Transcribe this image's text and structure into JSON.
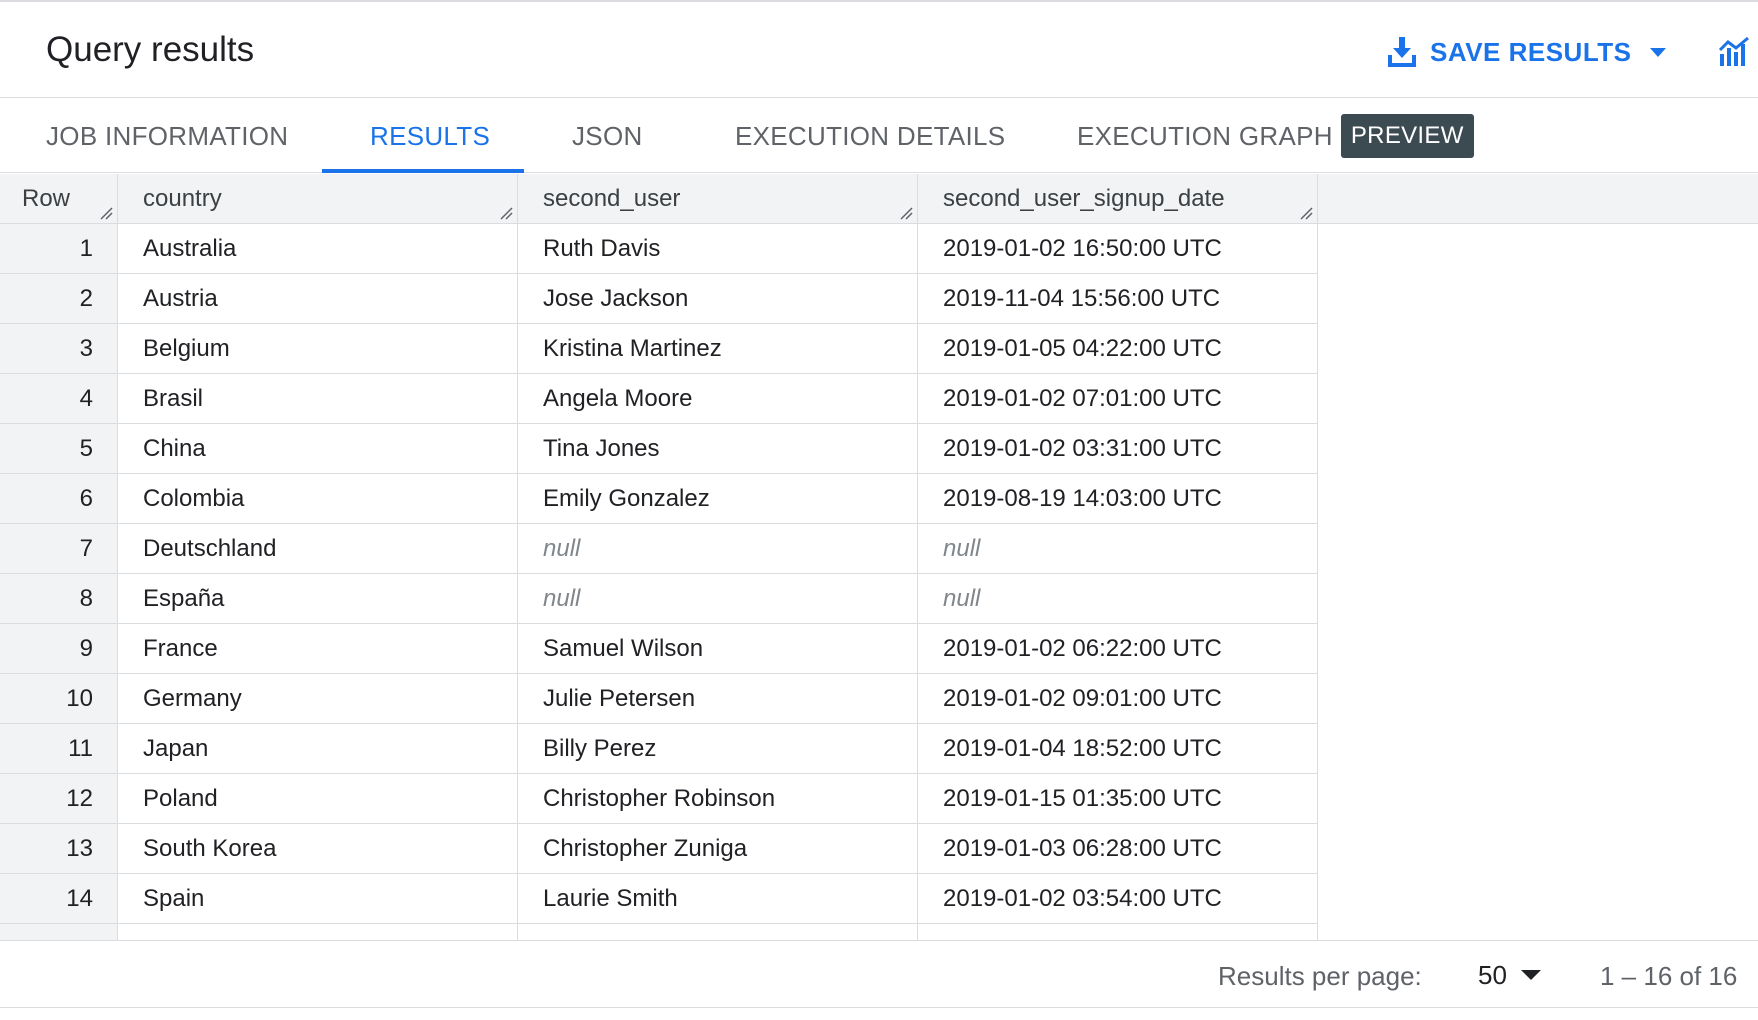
{
  "header": {
    "title": "Query results",
    "save_label": "SAVE RESULTS",
    "save_icon": "download-icon",
    "chart_icon": "explore-chart-icon",
    "accent_color": "#1a73e8"
  },
  "tabs": [
    {
      "label": "JOB INFORMATION",
      "active": false
    },
    {
      "label": "RESULTS",
      "active": true
    },
    {
      "label": "JSON",
      "active": false
    },
    {
      "label": "EXECUTION DETAILS",
      "active": false
    },
    {
      "label": "EXECUTION GRAPH",
      "active": false,
      "badge": "PREVIEW"
    }
  ],
  "table": {
    "columns": [
      "Row",
      "country",
      "second_user",
      "second_user_signup_date"
    ],
    "rows": [
      [
        "1",
        "Australia",
        "Ruth Davis",
        "2019-01-02 16:50:00 UTC"
      ],
      [
        "2",
        "Austria",
        "Jose Jackson",
        "2019-11-04 15:56:00 UTC"
      ],
      [
        "3",
        "Belgium",
        "Kristina Martinez",
        "2019-01-05 04:22:00 UTC"
      ],
      [
        "4",
        "Brasil",
        "Angela Moore",
        "2019-01-02 07:01:00 UTC"
      ],
      [
        "5",
        "China",
        "Tina Jones",
        "2019-01-02 03:31:00 UTC"
      ],
      [
        "6",
        "Colombia",
        "Emily Gonzalez",
        "2019-08-19 14:03:00 UTC"
      ],
      [
        "7",
        "Deutschland",
        "null",
        "null"
      ],
      [
        "8",
        "España",
        "null",
        "null"
      ],
      [
        "9",
        "France",
        "Samuel Wilson",
        "2019-01-02 06:22:00 UTC"
      ],
      [
        "10",
        "Germany",
        "Julie Petersen",
        "2019-01-02 09:01:00 UTC"
      ],
      [
        "11",
        "Japan",
        "Billy Perez",
        "2019-01-04 18:52:00 UTC"
      ],
      [
        "12",
        "Poland",
        "Christopher Robinson",
        "2019-01-15 01:35:00 UTC"
      ],
      [
        "13",
        "South Korea",
        "Christopher Zuniga",
        "2019-01-03 06:28:00 UTC"
      ],
      [
        "14",
        "Spain",
        "Laurie Smith",
        "2019-01-02 03:54:00 UTC"
      ]
    ]
  },
  "footer": {
    "results_per_page_label": "Results per page:",
    "results_per_page_value": "50",
    "range_text": "1 – 16 of 16"
  }
}
